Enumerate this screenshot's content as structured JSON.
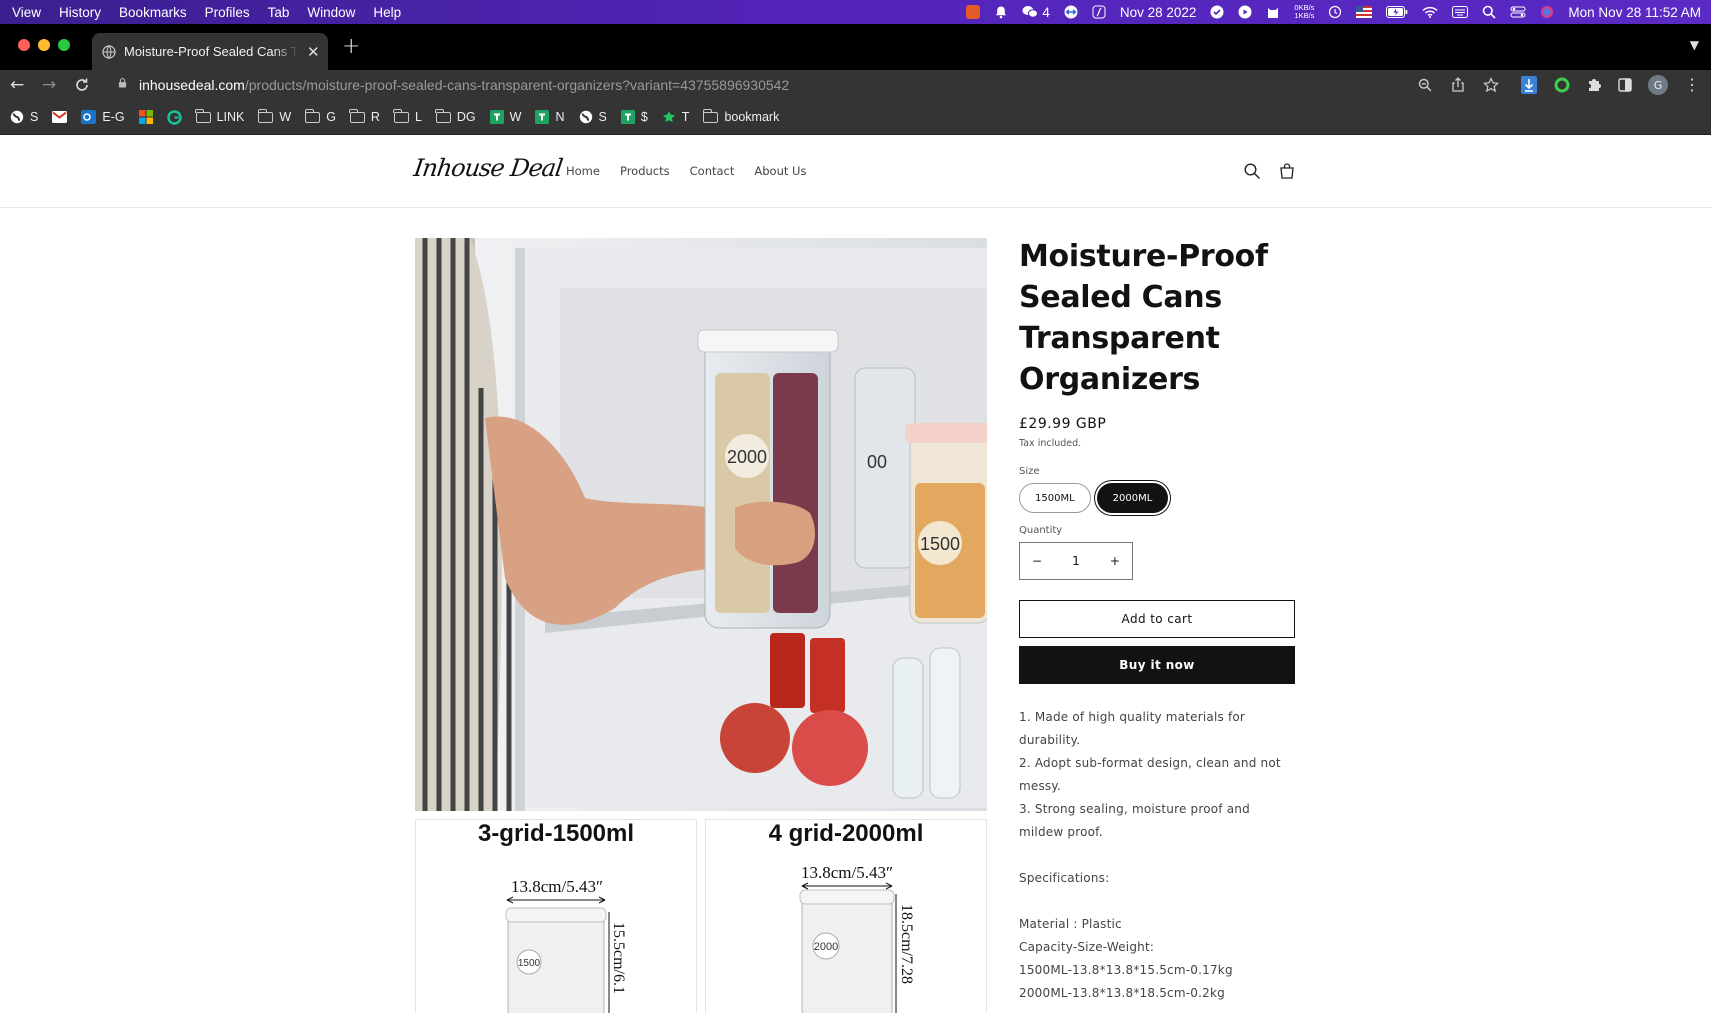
{
  "menubar": {
    "items": [
      "View",
      "History",
      "Bookmarks",
      "Profiles",
      "Tab",
      "Window",
      "Help"
    ],
    "notif_count": "4",
    "date_short": "Nov 28 2022",
    "net_up": "0KB/s",
    "net_down": "1KB/s",
    "datetime": "Mon Nov 28  11:52 AM"
  },
  "browser": {
    "tab_title": "Moisture-Proof Sealed Cans Transparent Organizers",
    "url_domain": "inhousedeal.com",
    "url_path": "/products/moisture-proof-sealed-cans-transparent-organizers?variant=43755896930542",
    "profile_initial": "G"
  },
  "bookmarks": [
    {
      "icon": "globe-icon",
      "label": "S"
    },
    {
      "icon": "gmail-icon",
      "label": ""
    },
    {
      "icon": "outlook-icon",
      "label": "E-G"
    },
    {
      "icon": "microsoft-icon",
      "label": ""
    },
    {
      "icon": "grammarly-icon",
      "label": ""
    },
    {
      "icon": "folder-icon",
      "label": "LINK"
    },
    {
      "icon": "folder-icon",
      "label": "W"
    },
    {
      "icon": "folder-icon",
      "label": "G"
    },
    {
      "icon": "folder-icon",
      "label": "R"
    },
    {
      "icon": "folder-icon",
      "label": "L"
    },
    {
      "icon": "folder-icon",
      "label": "DG"
    },
    {
      "icon": "green-cross-icon",
      "label": "W"
    },
    {
      "icon": "green-cross-icon",
      "label": "N"
    },
    {
      "icon": "globe-icon",
      "label": "S"
    },
    {
      "icon": "green-cross-icon",
      "label": "$"
    },
    {
      "icon": "star-icon",
      "label": "T"
    },
    {
      "icon": "folder-icon",
      "label": "bookmark"
    }
  ],
  "store": {
    "logo": "Inhouse Deal",
    "nav": [
      "Home",
      "Products",
      "Contact",
      "About Us"
    ]
  },
  "product": {
    "title": "Moisture-Proof Sealed Cans Transparent Organizers",
    "price": "£29.99 GBP",
    "tax_note": "Tax included.",
    "size_label": "Size",
    "sizes": [
      "1500ML",
      "2000ML"
    ],
    "selected_size": "2000ML",
    "quantity_label": "Quantity",
    "quantity": "1",
    "add_to_cart": "Add to cart",
    "buy_now": "Buy it now",
    "image_text": {
      "main_jar_label": "2000",
      "side_jar_label": "1500",
      "back_jar_label": "00",
      "thumb1_caption": "3-grid-1500ml",
      "thumb1_width": "13.8cm/5.43″",
      "thumb1_height": "15.5cm/6.1",
      "thumb1_jar": "1500",
      "thumb2_caption": "4 grid-2000ml",
      "thumb2_width": "13.8cm/5.43″",
      "thumb2_height": "18.5cm/7.28",
      "thumb2_jar": "2000"
    },
    "description": [
      "1. Made of high quality materials for durability.",
      "2. Adopt sub-format design, clean and not messy.",
      "3. Strong sealing, moisture proof and mildew proof.",
      "",
      "Specifications:",
      "",
      "Material : Plastic",
      "Capacity-Size-Weight:",
      "1500ML-13.8*13.8*15.5cm-0.17kg",
      "2000ML-13.8*13.8*18.5cm-0.2kg"
    ]
  }
}
